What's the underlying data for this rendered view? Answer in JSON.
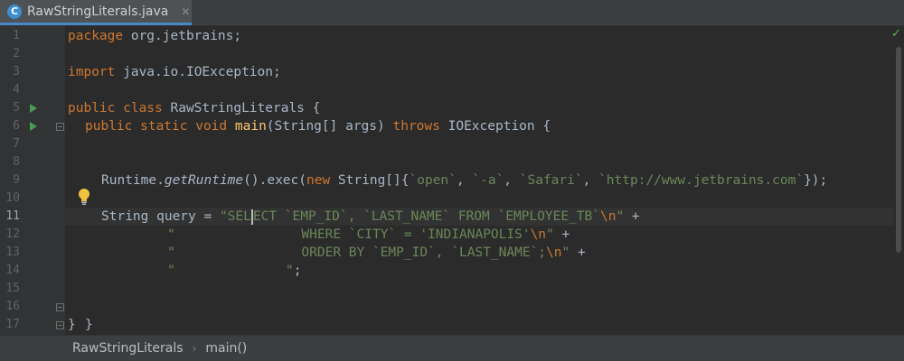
{
  "tab": {
    "icon_letter": "C",
    "label": "RawStringLiterals.java",
    "close": "✕"
  },
  "editor": {
    "line_numbers": [
      "1",
      "2",
      "3",
      "4",
      "5",
      "6",
      "7",
      "8",
      "9",
      "10",
      "11",
      "12",
      "13",
      "14",
      "15",
      "16",
      "17"
    ],
    "code": {
      "l1_kw": "package",
      "l1_rest": " org.jetbrains;",
      "l3_kw": "import",
      "l3_rest": " java.io.IOException;",
      "l5_kw": "public class",
      "l5_rest": " RawStringLiterals {",
      "l6_kw": "public static void",
      "l6_fn": "main",
      "l6_mid": "(String[] args) ",
      "l6_kw2": "throws",
      "l6_rest": " IOException {",
      "l9_a": "Runtime.",
      "l9_b": "getRuntime",
      "l9_c": "().exec(",
      "l9_d": "new",
      "l9_e": " String[]{",
      "l9_s1": "`open`",
      "l9_s2": "`-a`",
      "l9_s3": "`Safari`",
      "l9_s4": "`http://www.jetbrains.com`",
      "l9_comma": ", ",
      "l9_end": "});",
      "l11_a": "String query = ",
      "l11_s1": "\"SEL",
      "l11_s2": "ECT `EMP_ID`, `LAST_NAME` FROM `EMPLOYEE_TB`",
      "l11_esc": "\\n",
      "l11_q": "\"",
      "l11_end": " +",
      "l12_s": "\"                WHERE `CITY` = 'INDIANAPOLIS'",
      "l12_esc": "\\n",
      "l12_q": "\"",
      "l12_end": " +",
      "l13_s": "\"                ORDER BY `EMP_ID`, `LAST_NAME`;",
      "l13_esc": "\\n",
      "l13_q": "\"",
      "l13_end": " +",
      "l14_s": "\"              \"",
      "l14_end": ";",
      "l16": "}",
      "l17": "}"
    }
  },
  "breadcrumbs": {
    "class_name": "RawStringLiterals",
    "separator": "›",
    "method": "main()"
  },
  "status": {
    "check": "✓"
  },
  "colors": {
    "keyword": "#cc7832",
    "string": "#6a8759",
    "function": "#ffc66d",
    "text": "#a9b7c6",
    "background": "#2b2b2b"
  }
}
